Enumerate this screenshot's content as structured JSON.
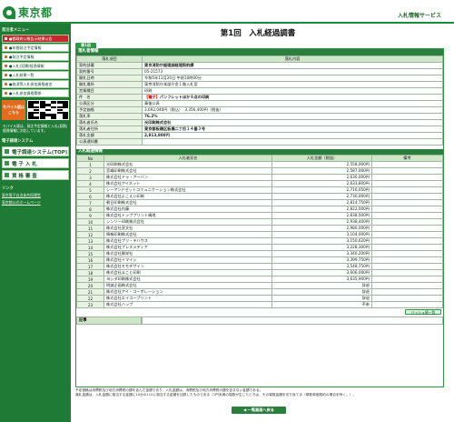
{
  "header": {
    "logo_text": "東京都",
    "service_name": "入札情報サービス"
  },
  "sidebar": {
    "menu_heading": "発注者メニュー",
    "items": [
      {
        "label": "●都政府公報告示結果公告",
        "style": "red"
      },
      {
        "label": "●年間発注予定情報",
        "style": "normal"
      },
      {
        "label": "●発注予定情報",
        "style": "normal"
      },
      {
        "label": "●入札(見積)経過情報",
        "style": "normal"
      },
      {
        "label": "●入札結果一覧",
        "style": "normal"
      },
      {
        "label": "●取消等入札参加資格者名",
        "style": "normal"
      },
      {
        "label": "●入札参加資格関係",
        "style": "normal"
      }
    ],
    "mobile_badge": "モバイル版はこちら",
    "mobile_note": "モバイル版は、発注予定情報と入札(見積)経過情報に対応しています。",
    "system_heading": "電子調達システム",
    "system_buttons": [
      {
        "label": "電子調達システム(TOP)"
      },
      {
        "label": "電 子 入 札"
      },
      {
        "label": "資 格 審 査"
      }
    ],
    "links_heading": "リンク",
    "links": [
      {
        "label": "東京電子自治体共同運営"
      },
      {
        "label": "東京都公式ホームページ"
      }
    ]
  },
  "main": {
    "title": "第1回　入札経過調書",
    "tab_label": "第1回"
  },
  "info_section": {
    "heading": "落札者情報",
    "col_item": "落札項目",
    "col_content": "落札内容",
    "rows": [
      {
        "label": "契約部署",
        "value": "東京消防庁経理部経理契約課",
        "style": "bold"
      },
      {
        "label": "契約番号",
        "value": "05-21573",
        "style": ""
      },
      {
        "label": "開札日時",
        "value": "令和5年11月20日 午前10時00分",
        "style": ""
      },
      {
        "label": "開札場所",
        "value": "東京消防庁本部庁舎１階入札室",
        "style": ""
      },
      {
        "label": "営業種目",
        "value": "印刷",
        "style": ""
      },
      {
        "label": "件　名",
        "prefix": "【電子】",
        "value": "パンフレットほか８点の印刷",
        "style": "bold"
      },
      {
        "label": "公表区分",
        "value": "事後公表",
        "style": ""
      },
      {
        "label": "予定価格",
        "value": "3,692,040円（税込）　3,356,400円（税抜）",
        "style": ""
      },
      {
        "label": "落札率",
        "value": "76.2%",
        "style": "bold"
      },
      {
        "label": "落札者氏名",
        "value": "光印刷株式会社",
        "style": "bold"
      },
      {
        "label": "落札者住所",
        "value": "東京都板橋区板橋二丁目１４番３号",
        "style": "bold"
      },
      {
        "label": "落札金額",
        "value": "2,813,800円",
        "style": "bold"
      },
      {
        "label": "公表通知書",
        "value": "",
        "style": ""
      }
    ]
  },
  "bids_section": {
    "heading": "入札経過情報",
    "col_no": "No",
    "col_name": "入札者氏名",
    "col_amount": "入札金額（税抜）",
    "col_note": "備考",
    "rows": [
      {
        "no": "1",
        "name": "光印刷株式会社",
        "amount": "2,558,000円",
        "note": ""
      },
      {
        "no": "2",
        "name": "宮嶋印刷株式会社",
        "amount": "2,587,000円",
        "note": ""
      },
      {
        "no": "3",
        "name": "株式会社ドゥ・アーバン",
        "amount": "2,630,000円",
        "note": ""
      },
      {
        "no": "4",
        "name": "株式会社アイネット",
        "amount": "2,633,800円",
        "note": ""
      },
      {
        "no": "5",
        "name": "シーアンドゼットコミュニケーション株式会社",
        "amount": "2,716,050円",
        "note": ""
      },
      {
        "no": "6",
        "name": "株式会社よこえい印刷",
        "amount": "2,730,000円",
        "note": ""
      },
      {
        "no": "7",
        "name": "朝日印刷株式会社",
        "amount": "2,814,750円",
        "note": ""
      },
      {
        "no": "8",
        "name": "株式会社内藤",
        "amount": "2,822,000円",
        "note": ""
      },
      {
        "no": "9",
        "name": "株式会社トッププリント嶋地",
        "amount": "2,838,500円",
        "note": ""
      },
      {
        "no": "10",
        "name": "シンソー印刷株式会社",
        "amount": "2,938,400円",
        "note": ""
      },
      {
        "no": "11",
        "name": "株式会社宣文社",
        "amount": "2,980,000円",
        "note": ""
      },
      {
        "no": "12",
        "name": "情報印刷株式会社",
        "amount": "3,104,000円",
        "note": ""
      },
      {
        "no": "13",
        "name": "株式会社プリ・テハウス",
        "amount": "3,150,620円",
        "note": ""
      },
      {
        "no": "14",
        "name": "株式会社プレスメディア",
        "amount": "3,228,300円",
        "note": ""
      },
      {
        "no": "15",
        "name": "株式会社勝栄社",
        "amount": "3,340,200円",
        "note": ""
      },
      {
        "no": "16",
        "name": "株式会社イマイシ",
        "amount": "3,399,750円",
        "note": ""
      },
      {
        "no": "17",
        "name": "株式会社モモデザイン",
        "amount": "3,548,750円",
        "note": ""
      },
      {
        "no": "18",
        "name": "株式会社まこと印刷",
        "amount": "3,606,000円",
        "note": ""
      },
      {
        "no": "19",
        "name": "ヨシダ印刷株式会社",
        "amount": "3,635,900円",
        "note": ""
      },
      {
        "no": "20",
        "name": "明誠企画株式会社",
        "amount": "辞退",
        "note": ""
      },
      {
        "no": "21",
        "name": "株式会社アイ・コーポレーション",
        "amount": "辞退",
        "note": ""
      },
      {
        "no": "22",
        "name": "株式会社エイコープリント",
        "amount": "辞退",
        "note": ""
      },
      {
        "no": "23",
        "name": "株式会社ハップ",
        "amount": "不参",
        "note": ""
      }
    ]
  },
  "history_button": "ハッシュ値一覧",
  "remarks_label": "記事",
  "remarks_value": "",
  "footnote_1": "予定価格は消費税及び地方消費税の額を含んだ金額であり、入札金額は、消費税及び地方消費税の額を含まない金額である。",
  "footnote_2": "落札金額は、入札金額に相当する金額に10分の110に相当する金額を加算したものである（1円未満の端数が生じたときは、その端数金額を切り捨てる（単数単価契約の場合を除く。）。",
  "back_button": "◀ 一覧画面へ戻る",
  "colors": {
    "brand_green": "#1d8a3a",
    "sidebar_green": "#1f7a35",
    "table_head": "#cfe6c9",
    "accent_orange": "#e36b1e",
    "accent_red": "#c9272d"
  }
}
